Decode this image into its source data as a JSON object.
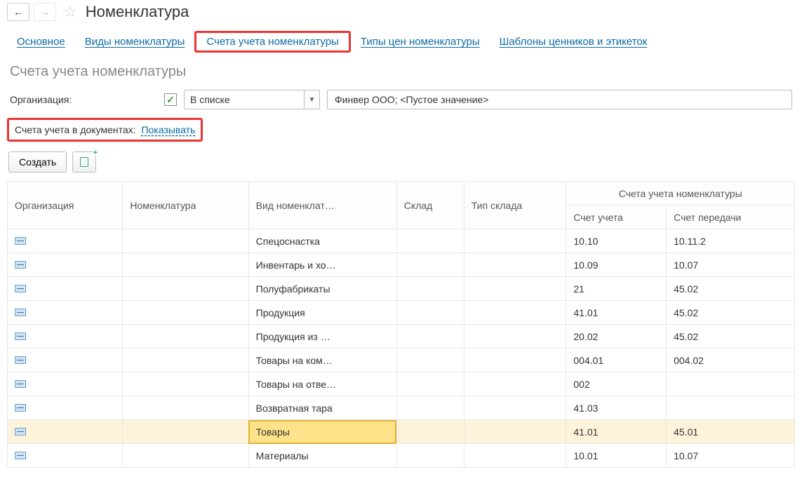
{
  "title": "Номенклатура",
  "tabs": [
    {
      "label": "Основное"
    },
    {
      "label": "Виды номенклатуры"
    },
    {
      "label": "Счета учета номенклатуры"
    },
    {
      "label": "Типы цен номенклатуры"
    },
    {
      "label": "Шаблоны ценников и этикеток"
    }
  ],
  "section_title": "Счета учета номенклатуры",
  "filter": {
    "org_label": "Организация:",
    "mode": "В списке",
    "value": "Финвер ООО; <Пустое значение>"
  },
  "show_docs": {
    "label": "Счета учета в документах:",
    "link": "Показывать"
  },
  "toolbar": {
    "create": "Создать"
  },
  "columns": {
    "org": "Организация",
    "nomen": "Номенклатура",
    "kind": "Вид номенклат…",
    "warehouse": "Склад",
    "wh_type": "Тип склада",
    "accounts_group": "Счета учета номенклатуры",
    "acc": "Счет учета",
    "acc_transfer": "Счет передачи"
  },
  "rows": [
    {
      "kind": "Спецоснастка",
      "acc": "10.10",
      "transfer": "10.11.2"
    },
    {
      "kind": "Инвентарь и хо…",
      "acc": "10.09",
      "transfer": "10.07"
    },
    {
      "kind": "Полуфабрикаты",
      "acc": "21",
      "transfer": "45.02"
    },
    {
      "kind": "Продукция",
      "acc": "41.01",
      "transfer": "45.02"
    },
    {
      "kind": "Продукция из …",
      "acc": "20.02",
      "transfer": "45.02"
    },
    {
      "kind": "Товары на ком…",
      "acc": "004.01",
      "transfer": "004.02"
    },
    {
      "kind": "Товары на отве…",
      "acc": "002",
      "transfer": ""
    },
    {
      "kind": "Возвратная тара",
      "acc": "41.03",
      "transfer": ""
    },
    {
      "kind": "Товары",
      "acc": "41.01",
      "transfer": "45.01",
      "selected": true
    },
    {
      "kind": "Материалы",
      "acc": "10.01",
      "transfer": "10.07"
    }
  ]
}
